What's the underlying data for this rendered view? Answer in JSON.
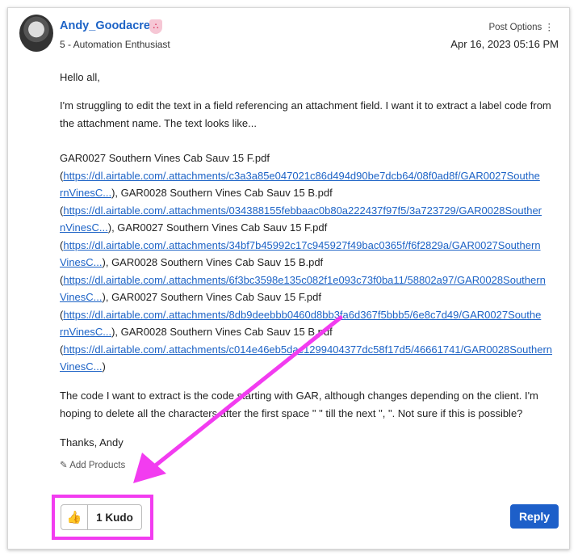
{
  "post": {
    "author": "Andy_Goodacre",
    "rank": "5 - Automation Enthusiast",
    "options": "Post Options",
    "options_icon": "⋮",
    "date": "Apr 16, 2023 05:16 PM",
    "greeting": "Hello all,",
    "intro": [
      "I'm struggling to edit the text in a field referencing an attachment field. I want it to extract a label code from",
      "the attachment name. The text looks like..."
    ],
    "lines": [
      [
        {
          "t": "GAR0027 Southern Vines Cab Sauv 15 F.pdf"
        }
      ],
      [
        {
          "t": "("
        },
        {
          "l": "https://dl.airtable.com/.attachments/c3a3a85e047021c86d494d90be7dcb64/08f0ad8f/GAR0027Southe"
        }
      ],
      [
        {
          "l": "rnVinesC..."
        },
        {
          "t": "), GAR0028 Southern Vines Cab Sauv 15 B.pdf"
        }
      ],
      [
        {
          "t": "("
        },
        {
          "l": "https://dl.airtable.com/.attachments/034388155febbaac0b80a222437f97f5/3a723729/GAR0028Souther"
        }
      ],
      [
        {
          "l": "nVinesC..."
        },
        {
          "t": "), GAR0027 Southern Vines Cab Sauv 15 F.pdf"
        }
      ],
      [
        {
          "t": "("
        },
        {
          "l": "https://dl.airtable.com/.attachments/34bf7b45992c17c945927f49bac0365f/f6f2829a/GAR0027Southern"
        }
      ],
      [
        {
          "l": "VinesC..."
        },
        {
          "t": "), GAR0028 Southern Vines Cab Sauv 15 B.pdf"
        }
      ],
      [
        {
          "t": "("
        },
        {
          "l": "https://dl.airtable.com/.attachments/6f3bc3598e135c082f1e093c73f0ba11/58802a97/GAR0028Southern"
        }
      ],
      [
        {
          "l": "VinesC..."
        },
        {
          "t": "), GAR0027 Southern Vines Cab Sauv 15 F.pdf"
        }
      ],
      [
        {
          "t": "("
        },
        {
          "l": "https://dl.airtable.com/.attachments/8db9deebbb0460d8bb3fa6d367f5bbb5/6e8c7d49/GAR0027Southe"
        }
      ],
      [
        {
          "l": "rnVinesC..."
        },
        {
          "t": "), GAR0028 Southern Vines Cab Sauv 15 B.pdf"
        }
      ],
      [
        {
          "t": "("
        },
        {
          "l": "https://dl.airtable.com/.attachments/c014e46eb5dac1299404377dc58f17d5/46661741/GAR0028Southern"
        }
      ],
      [
        {
          "l": "VinesC..."
        },
        {
          "t": ")"
        }
      ]
    ],
    "question": [
      "The code I want to extract is the code starting with GAR, although changes depending on the client. I'm",
      "hoping to delete all the characters after the first space \" \" till the next \", \". Not sure if this is possible?"
    ],
    "signoff": "Thanks, Andy",
    "add_products": "Add Products",
    "kudo_label": "1 Kudo",
    "reply_label": "Reply"
  },
  "colors": {
    "link": "#1d63c6",
    "highlight": "#f23cf0",
    "reply": "#1d5fc9"
  }
}
